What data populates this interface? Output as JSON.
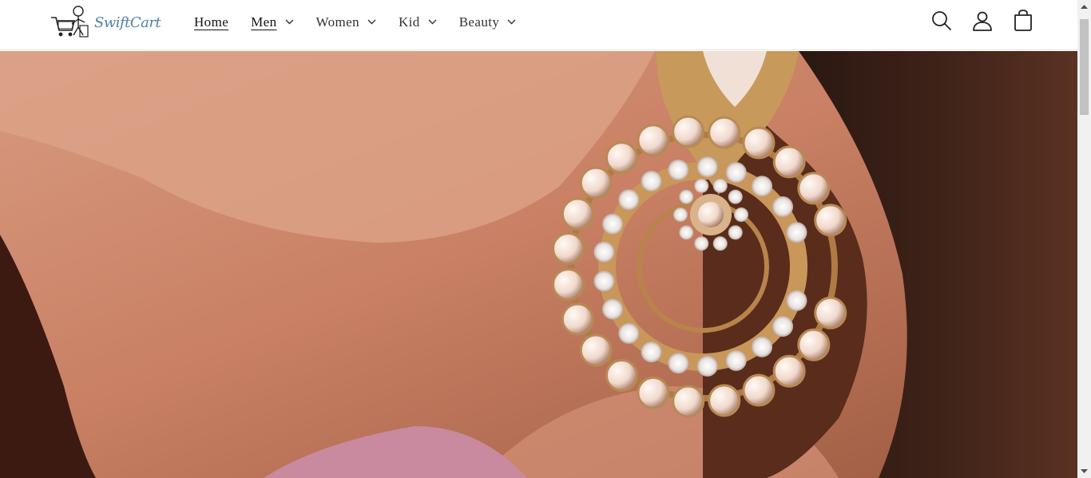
{
  "brand": {
    "name": "SwiftCart"
  },
  "nav": {
    "items": [
      {
        "label": "Home",
        "active": true,
        "has_dropdown": false
      },
      {
        "label": "Men",
        "active": false,
        "has_dropdown": true
      },
      {
        "label": "Women",
        "active": false,
        "has_dropdown": true
      },
      {
        "label": "Kid",
        "active": false,
        "has_dropdown": true
      },
      {
        "label": "Beauty",
        "active": false,
        "has_dropdown": true
      }
    ]
  },
  "header_icons": [
    "search-icon",
    "account-icon",
    "cart-icon"
  ],
  "hero": {
    "image": "close-up of pearl and crystal chandbali earring"
  },
  "colors": {
    "header_bg": "#ffffff",
    "text": "#121212",
    "logo": "#4f7fa8"
  }
}
